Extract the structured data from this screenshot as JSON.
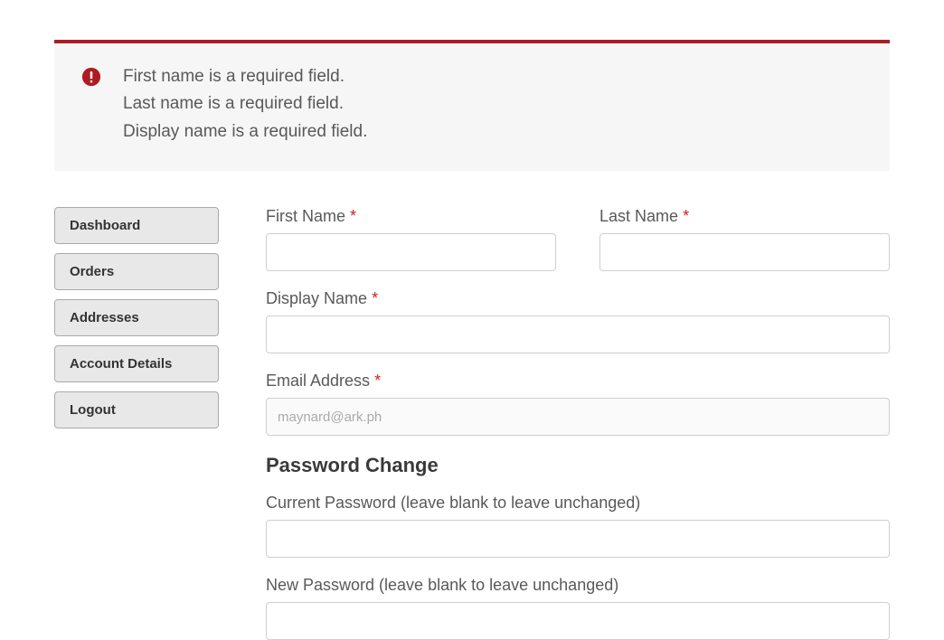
{
  "colors": {
    "accent": "#AE1C23",
    "error": "#AE1C23"
  },
  "alert": {
    "lines": [
      "First name is a required field.",
      "Last name is a required field.",
      "Display name is a required field."
    ]
  },
  "sidebar": {
    "items": [
      {
        "label": "Dashboard"
      },
      {
        "label": "Orders"
      },
      {
        "label": "Addresses"
      },
      {
        "label": "Account Details"
      },
      {
        "label": "Logout"
      }
    ]
  },
  "form": {
    "first_name_label": "First Name",
    "first_name_value": "",
    "last_name_label": "Last Name",
    "last_name_value": "",
    "display_name_label": "Display Name",
    "display_name_value": "",
    "email_label": "Email Address",
    "email_value": "maynard@ark.ph",
    "required_mark": "*"
  },
  "password_section": {
    "heading": "Password Change",
    "current_label": "Current Password (leave blank to leave unchanged)",
    "current_value": "",
    "new_label": "New Password (leave blank to leave unchanged)",
    "new_value": ""
  }
}
